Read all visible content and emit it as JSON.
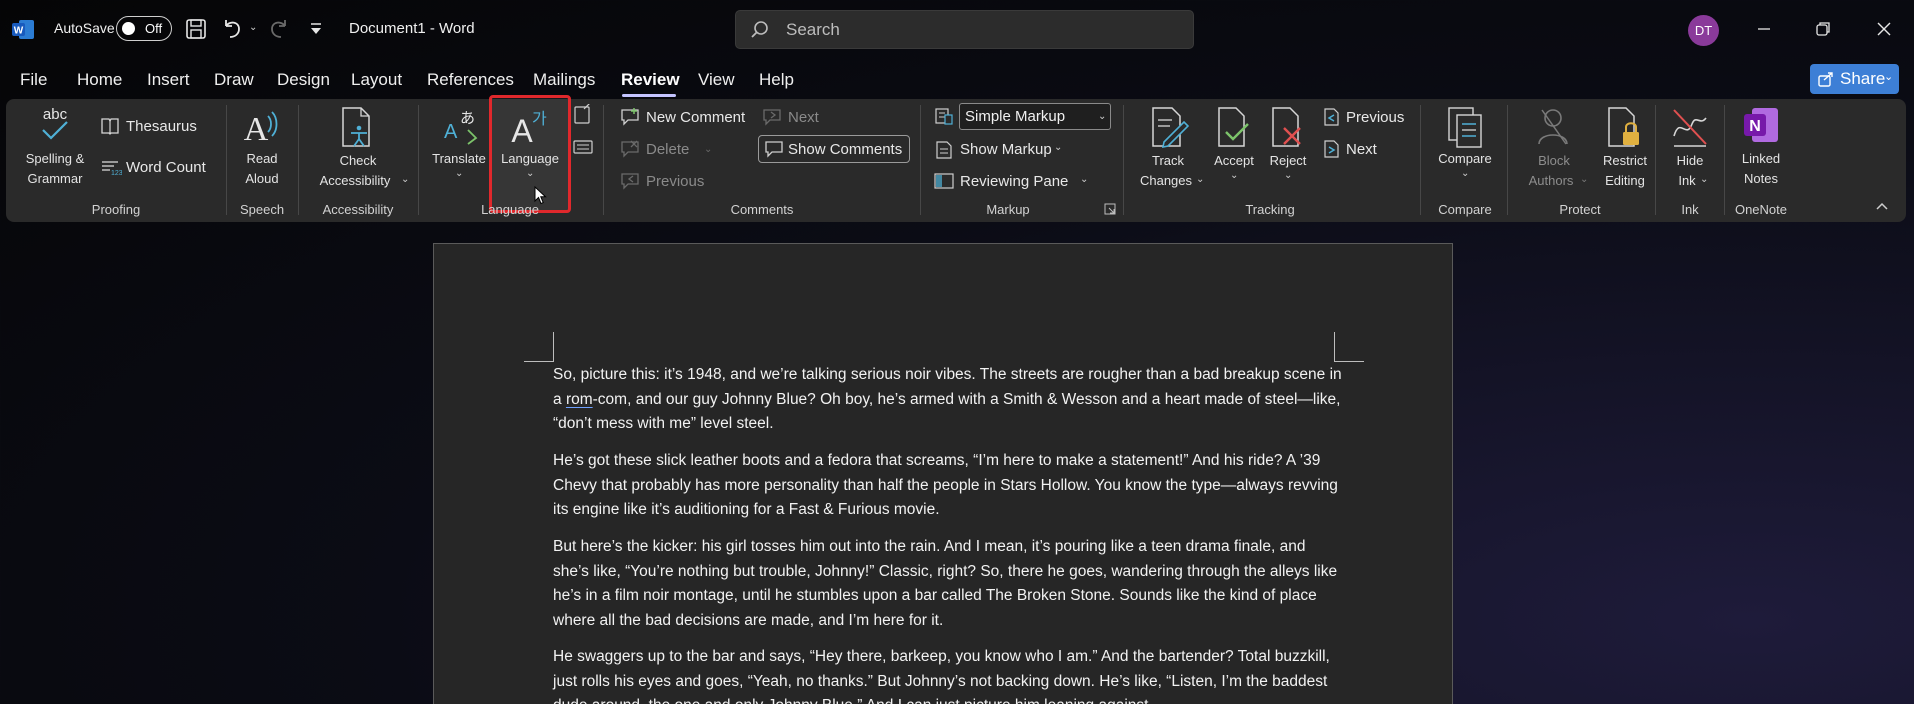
{
  "app": {
    "doc_title": "Document1  -  Word",
    "autosave_label": "AutoSave",
    "autosave_state": "Off",
    "search_placeholder": "Search",
    "user_initials": "DT"
  },
  "menu": {
    "tabs": [
      "File",
      "Home",
      "Insert",
      "Draw",
      "Design",
      "Layout",
      "References",
      "Mailings",
      "Review",
      "View",
      "Help"
    ],
    "active_tab": "Review",
    "share_label": "Share"
  },
  "ribbon": {
    "proofing": {
      "group": "Proofing",
      "spelling": [
        "Spelling &",
        "Grammar"
      ],
      "thesaurus": "Thesaurus",
      "word_count": "Word Count"
    },
    "speech": {
      "group": "Speech",
      "read_aloud": [
        "Read",
        "Aloud"
      ]
    },
    "accessibility": {
      "group": "Accessibility",
      "check": [
        "Check",
        "Accessibility"
      ]
    },
    "language": {
      "group": "Language",
      "translate": "Translate",
      "language": "Language"
    },
    "comments": {
      "group": "Comments",
      "new_comment": "New Comment",
      "delete": "Delete",
      "previous": "Previous",
      "next": "Next",
      "show_comments": "Show Comments"
    },
    "markup": {
      "group": "Markup",
      "simple_markup": "Simple Markup",
      "show_markup": "Show Markup",
      "reviewing_pane": "Reviewing Pane"
    },
    "tracking": {
      "group": "Tracking",
      "track_changes": [
        "Track",
        "Changes"
      ],
      "accept": "Accept",
      "reject": "Reject",
      "previous": "Previous",
      "next": "Next"
    },
    "compare": {
      "group": "Compare",
      "compare": "Compare"
    },
    "protect": {
      "group": "Protect",
      "block_authors": [
        "Block",
        "Authors"
      ],
      "restrict_editing": [
        "Restrict",
        "Editing"
      ]
    },
    "ink": {
      "group": "Ink",
      "hide_ink": [
        "Hide",
        "Ink"
      ]
    },
    "onenote": {
      "group": "OneNote",
      "linked_notes": [
        "Linked",
        "Notes"
      ]
    }
  },
  "document": {
    "p1": {
      "a": "So, picture this: it’s 1948, and we’re talking serious noir vibes. The streets are rougher than a bad breakup scene in a ",
      "u": "rom",
      "b": "-com, and our guy Johnny Blue? Oh boy, he’s armed with a Smith & Wesson and a heart made of steel—like, “don’t mess with me” level steel."
    },
    "p2": "He’s got these slick leather boots and a fedora that screams, “I’m here to make a statement!” And his ride? A ’39 Chevy that probably has more personality than half the people in Stars Hollow. You know the type—always revving its engine like it’s auditioning for a Fast & Furious movie.",
    "p3": "But here’s the kicker: his girl tosses him out into the rain. And I mean, it’s pouring like a teen drama finale, and she’s like, “You’re nothing but trouble, Johnny!” Classic, right? So, there he goes, wandering through the alleys like he’s in a film noir montage, until he stumbles upon a bar called The Broken Stone. Sounds like the kind of place where all the bad decisions are made, and I’m here for it.",
    "p4": "He swaggers up to the bar and says, “Hey there, barkeep, you know who I am.” And the bartender? Total buzzkill, just rolls his eyes and goes, “Yeah, no thanks.” But Johnny’s not backing down. He’s like, “Listen, I’m the baddest dude around, the one and only Johnny Blue.” And I can just picture him leaning against"
  },
  "colors": {
    "accent": "#c4c4ff",
    "share": "#3d7fd6",
    "highlight": "#e0282c",
    "avatar": "#8a3a9a"
  }
}
